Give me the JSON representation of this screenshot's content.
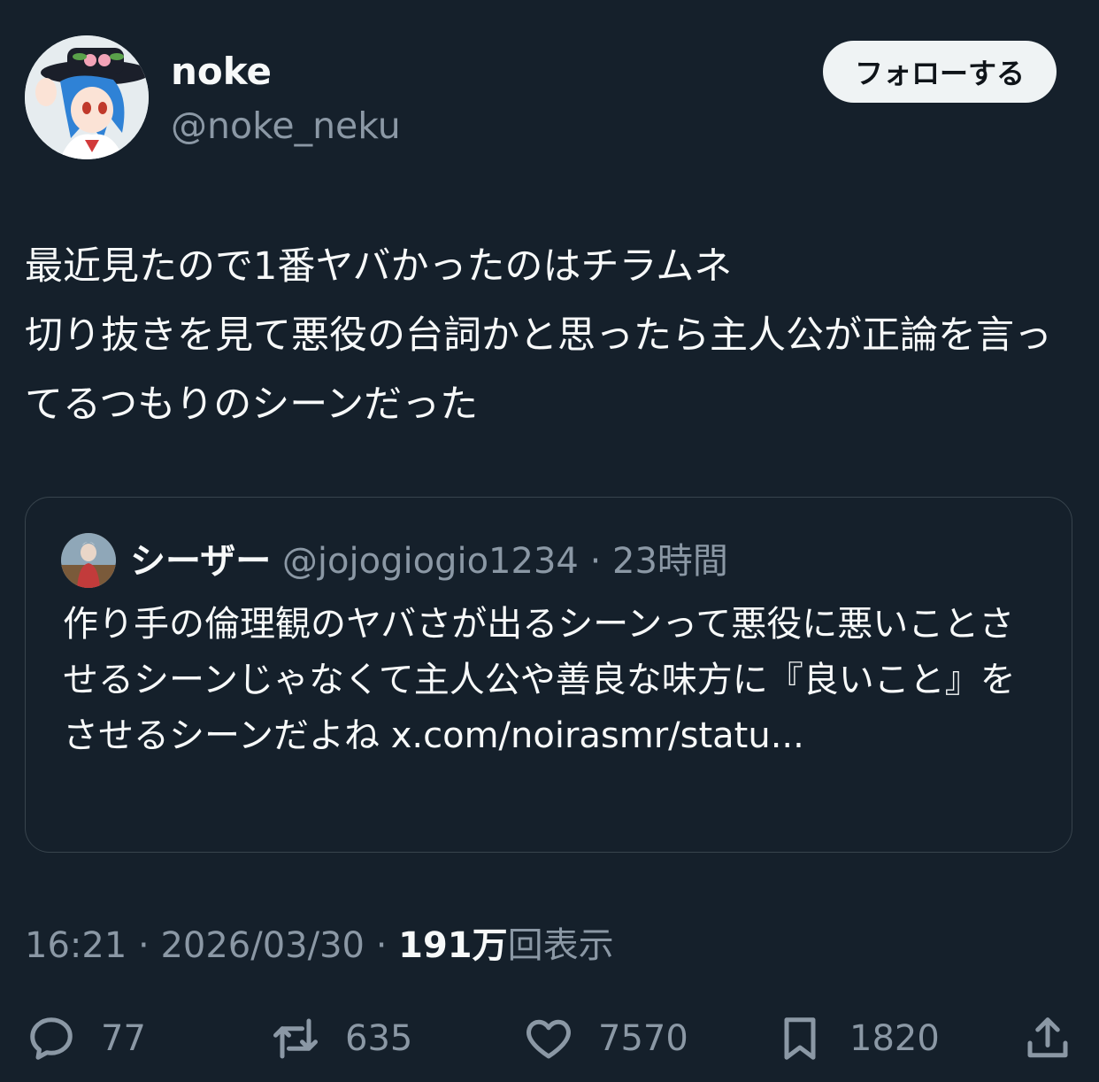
{
  "author": {
    "name": "noke",
    "handle": "@noke_neku"
  },
  "follow_button": {
    "label": "フォローする"
  },
  "tweet": {
    "text": "最近見たので1番ヤバかったのはチラムネ\n切り抜きを見て悪役の台詞かと思ったら主人公が正論を言ってるつもりのシーンだった"
  },
  "quote": {
    "name": "シーザー",
    "handle": "@jojogiogio1234",
    "separator": "·",
    "time": "23時間",
    "text": "作り手の倫理観のヤバさが出るシーンって悪役に悪いことさせるシーンじゃなくて主人公や善良な味方に『良いこと』をさせるシーンだよね x.com/noirasmr/statu..."
  },
  "meta": {
    "time": "16:21",
    "separator": "·",
    "date": "2026/03/30",
    "views_count": "191万",
    "views_label": "回表示"
  },
  "actions": {
    "reply": {
      "icon": "reply-icon",
      "count": "77"
    },
    "retweet": {
      "icon": "retweet-icon",
      "count": "635"
    },
    "like": {
      "icon": "heart-icon",
      "count": "7570"
    },
    "bookmark": {
      "icon": "bookmark-icon",
      "count": "1820"
    },
    "share": {
      "icon": "share-icon"
    }
  },
  "colors": {
    "background": "#15202b",
    "text_primary": "#f7f9f9",
    "text_secondary": "#8b98a5",
    "border": "#38444d",
    "button_bg": "#eff3f4"
  }
}
